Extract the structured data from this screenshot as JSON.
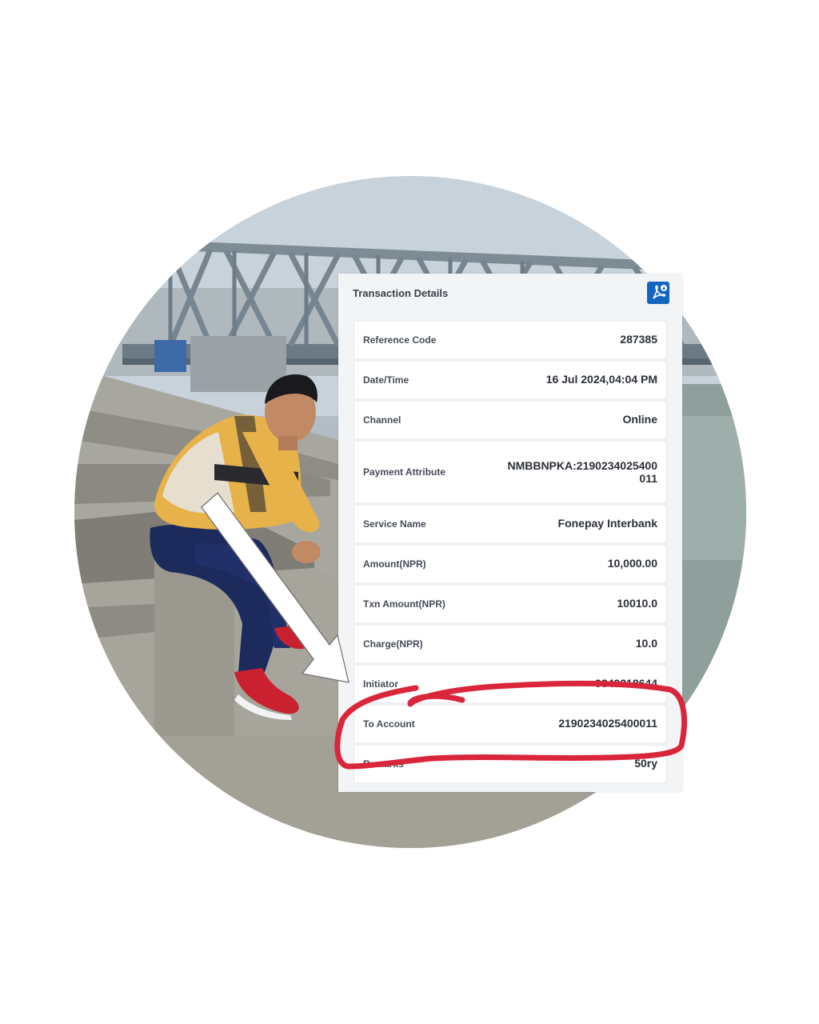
{
  "panel": {
    "title": "Transaction Details",
    "pdf_icon": "pdf-download-icon"
  },
  "rows": [
    {
      "label": "Reference Code",
      "value": "287385"
    },
    {
      "label": "Date/Time",
      "value": "16 Jul 2024,04:04 PM"
    },
    {
      "label": "Channel",
      "value": "Online"
    },
    {
      "label": "Payment Attribute",
      "value": "NMBBNPKA:2190234025400011"
    },
    {
      "label": "Service Name",
      "value": "Fonepay Interbank"
    },
    {
      "label": "Amount(NPR)",
      "value": "10,000.00"
    },
    {
      "label": "Txn Amount(NPR)",
      "value": "10010.0"
    },
    {
      "label": "Charge(NPR)",
      "value": "10.0"
    },
    {
      "label": "Initiator",
      "value": "9849218644"
    },
    {
      "label": "To Account",
      "value": "2190234025400011"
    },
    {
      "label": "Remarks",
      "value": "50ry"
    }
  ],
  "annotations": {
    "arrow_icon": "white-arrow-icon",
    "highlight_color": "#d9263b",
    "arrow_color": "#ffffff"
  }
}
